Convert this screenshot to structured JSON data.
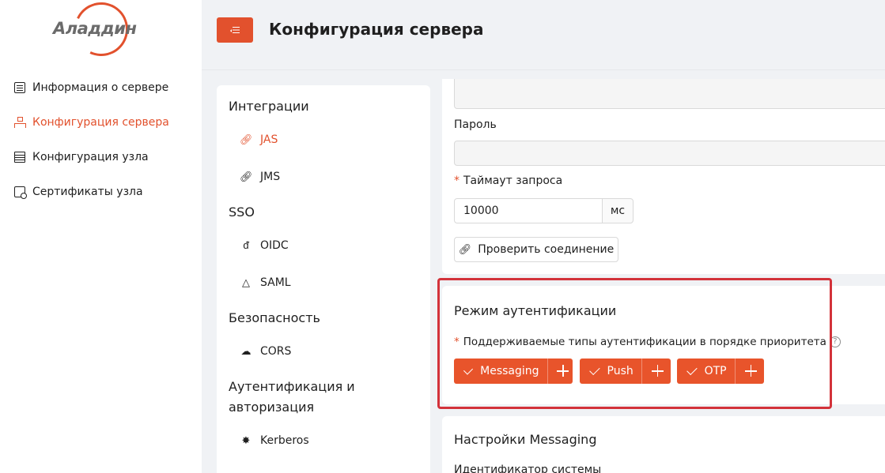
{
  "logo": {
    "text": "Аладдин"
  },
  "sidebar": {
    "items": [
      {
        "label": "Информация о сервере",
        "icon": "document-icon",
        "active": false
      },
      {
        "label": "Конфигурация сервера",
        "icon": "network-icon",
        "active": true
      },
      {
        "label": "Конфигурация узла",
        "icon": "server-icon",
        "active": false
      },
      {
        "label": "Сертификаты узла",
        "icon": "certificate-icon",
        "active": false
      }
    ]
  },
  "header": {
    "title": "Конфигурация сервера",
    "menu_icon": "menu-fold-icon"
  },
  "integrations": {
    "groups": [
      {
        "title": "Интеграции",
        "items": [
          {
            "label": "JAS",
            "icon": "link-icon",
            "active": true
          },
          {
            "label": "JMS",
            "icon": "link-icon",
            "active": false
          }
        ]
      },
      {
        "title": "SSO",
        "items": [
          {
            "label": "OIDC",
            "icon": "openid-icon"
          },
          {
            "label": "SAML",
            "icon": "saml-icon"
          }
        ]
      },
      {
        "title": "Безопасность",
        "items": [
          {
            "label": "CORS",
            "icon": "cloud-icon"
          }
        ]
      },
      {
        "title": "Аутентификация и авторизация",
        "title_line1": "Аутентификация и",
        "title_line2": "авторизация",
        "items": [
          {
            "label": "Kerberos",
            "icon": "kerberos-icon"
          }
        ]
      }
    ]
  },
  "form": {
    "password_label": "Пароль",
    "timeout_label": "Таймаут запроса",
    "timeout_value": "10000",
    "timeout_unit": "мс",
    "check_button": "Проверить соединение"
  },
  "auth_mode": {
    "title": "Режим аутентификации",
    "supported_label": "Поддерживаемые типы аутентификации в порядке приоритета",
    "help": "?",
    "tags": [
      "Messaging",
      "Push",
      "OTP"
    ]
  },
  "messaging": {
    "title": "Настройки Messaging",
    "system_id_label": "Идентификатор системы"
  },
  "colors": {
    "accent": "#e2512d",
    "highlight": "#d3323a"
  }
}
